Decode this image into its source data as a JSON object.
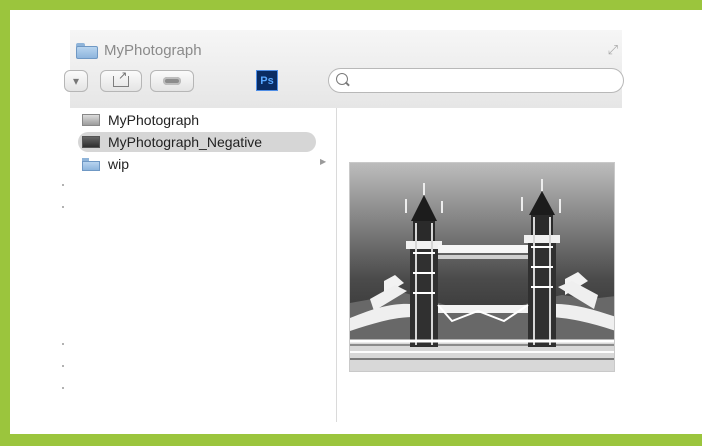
{
  "window": {
    "title": "MyPhotograph",
    "expand_icon": "expand-icon",
    "app_badge": "Ps"
  },
  "search": {
    "placeholder": "",
    "value": ""
  },
  "files": [
    {
      "name": "MyPhotograph",
      "icon": "image-file-icon",
      "selected": false
    },
    {
      "name": "MyPhotograph_Negative",
      "icon": "negative-image-file-icon",
      "selected": true
    },
    {
      "name": "wip",
      "icon": "folder-icon",
      "selected": false
    }
  ],
  "preview": {
    "subject_icon": "tower-bridge-negative-image"
  },
  "colors": {
    "frame_green": "#9bc53d",
    "selection_gray": "#d6d6d6",
    "photoshop_blue": "#0a2c63"
  }
}
